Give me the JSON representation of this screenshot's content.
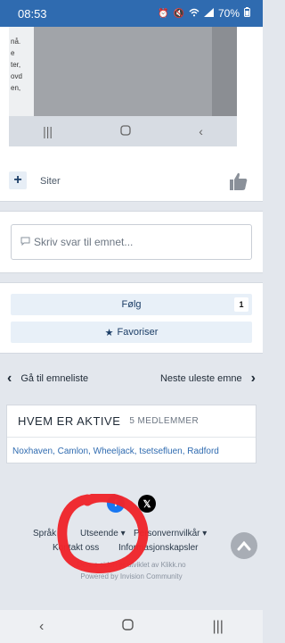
{
  "status_bar": {
    "time": "08:53",
    "battery": "70%"
  },
  "quote_post": {
    "screenshot_text_lines": [
      "nå.",
      "e",
      "ter,",
      "ovd",
      "en,"
    ],
    "quote_label": "Siter"
  },
  "reply": {
    "placeholder": "Skriv svar til emnet..."
  },
  "follow": {
    "follow_label": "Følg",
    "follow_count": "1",
    "favorite_label": "Favoriser"
  },
  "topic_nav": {
    "prev_label": "Gå til emneliste",
    "next_label": "Neste uleste emne"
  },
  "active_users": {
    "title": "HVEM ER AKTIVE",
    "count_label": "5 MEDLEMMER",
    "users": [
      "Noxhaven",
      "Camlon",
      "Wheeljack",
      "tsetsefluen",
      "Radford"
    ]
  },
  "footer": {
    "row1": [
      "Språk",
      "Utseende",
      "Personvernvilkår"
    ],
    "row2": [
      "Kontakt oss",
      "Informasjonskapsler"
    ],
    "credit1": "Denne siden er utviklet av Klikk.no",
    "credit2": "Powered by Invision Community"
  },
  "colors": {
    "status_bar": "#2f6bb0",
    "link": "#2f6bb0",
    "annotation": "#f0252b"
  }
}
